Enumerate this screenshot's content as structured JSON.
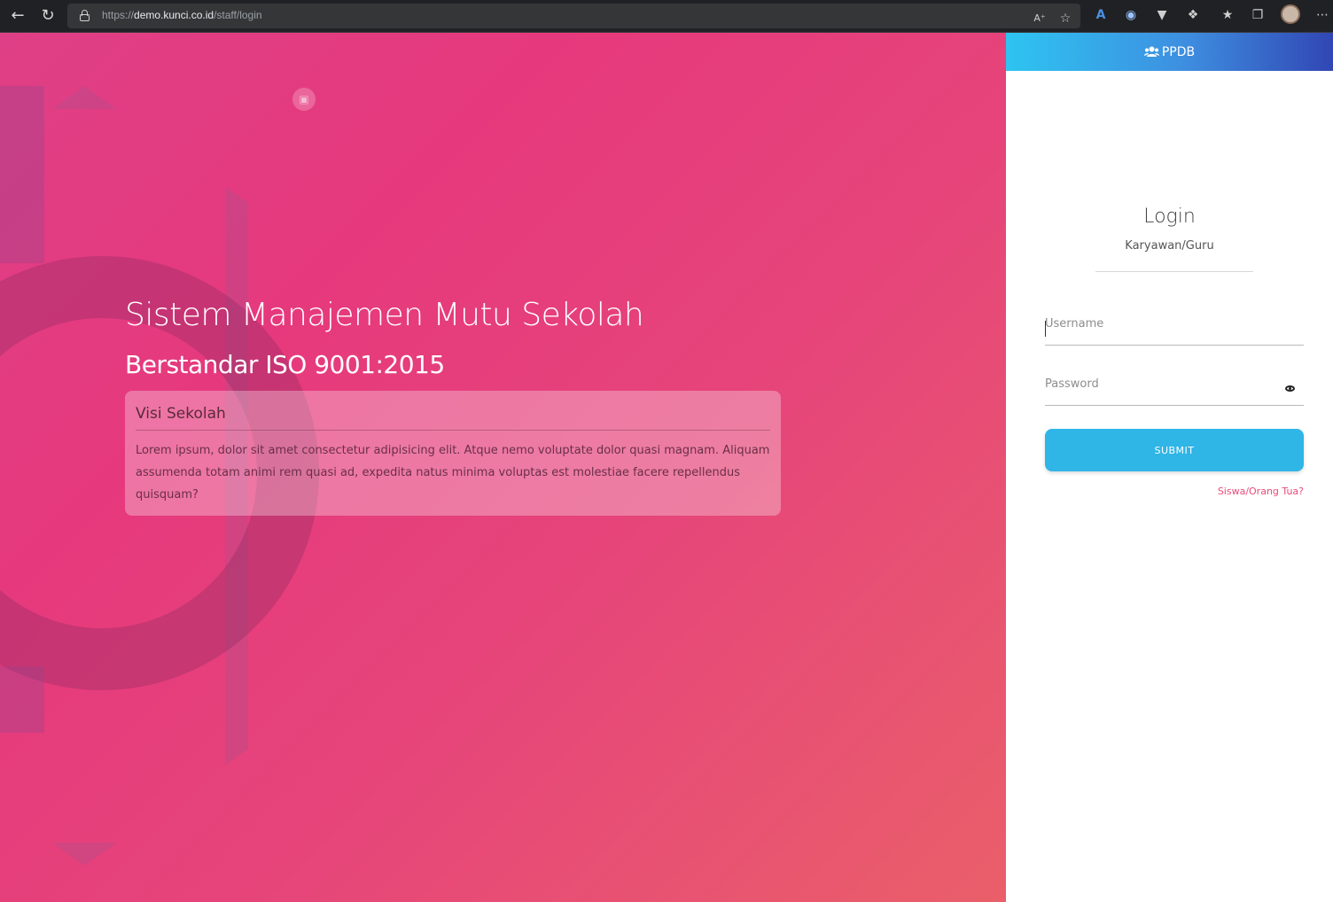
{
  "browser": {
    "url_scheme": "https://",
    "url_host": "demo.kunci.co.id",
    "url_path": "/staff/login",
    "icons": [
      "back-icon",
      "reload-icon",
      "lock-icon",
      "read-aloud-icon",
      "add-favorite-icon",
      "translate-icon",
      "extension-icon",
      "vue-devtools-icon",
      "puzzle-icon",
      "favorites-icon",
      "collections-icon",
      "avatar",
      "more-icon"
    ]
  },
  "hero": {
    "title": "Sistem Manajemen Mutu Sekolah",
    "subtitle": "Berstandar ISO 9001:2015",
    "vision": {
      "title": "Visi Sekolah",
      "text": "Lorem ipsum, dolor sit amet consectetur adipisicing elit. Atque nemo voluptate dolor quasi magnam. Aliquam assumenda totam animi rem quasi ad, expedita natus minima voluptas est molestiae facere repellendus quisquam?"
    }
  },
  "panel": {
    "ppdb_label": "PPDB",
    "login_title": "Login",
    "login_subtitle": "Karyawan/Guru",
    "username_placeholder": "Username",
    "password_placeholder": "Password",
    "submit_label": "SUBMIT",
    "alt_link": "Siswa/Orang Tua?"
  },
  "colors": {
    "hero_start": "#df3f86",
    "hero_end": "#ea5f6a",
    "ppdb_start": "#2ec4f1",
    "ppdb_end": "#3146b4",
    "submit": "#2fb5e6",
    "link": "#e94a79"
  }
}
